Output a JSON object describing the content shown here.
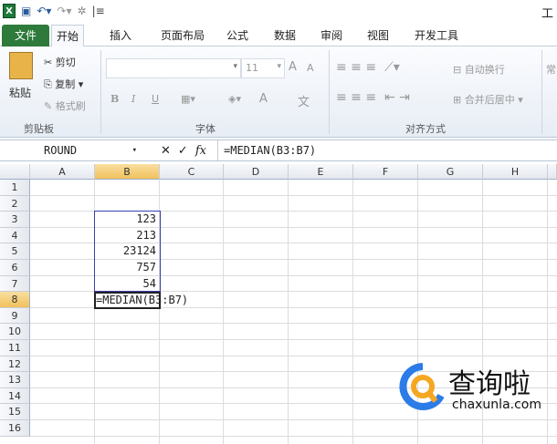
{
  "window": {
    "title": "工"
  },
  "tabs": [
    "文件",
    "开始",
    "插入",
    "页面布局",
    "公式",
    "数据",
    "审阅",
    "视图",
    "开发工具"
  ],
  "ribbon": {
    "clipboard": {
      "paste": "粘贴",
      "cut": "剪切",
      "copy": "复制",
      "format_painter": "格式刷",
      "label": "剪贴板"
    },
    "font": {
      "font_name": "",
      "font_size": "11",
      "label": "字体",
      "bold": "B",
      "italic": "I",
      "underline": "U",
      "font_color": "A",
      "grow": "A",
      "shrink": "A",
      "phonetic": "文"
    },
    "alignment": {
      "wrap_text": "自动换行",
      "merge_center": "合并后居中",
      "label": "对齐方式"
    },
    "number": {
      "format": "常"
    }
  },
  "formula_bar": {
    "name_box": "ROUND",
    "cancel": "✕",
    "enter": "✓",
    "fx": "fx",
    "formula": "=MEDIAN(B3:B7)"
  },
  "sheet": {
    "columns": [
      "A",
      "B",
      "C",
      "D",
      "E",
      "F",
      "G",
      "H"
    ],
    "rows": [
      "1",
      "2",
      "3",
      "4",
      "5",
      "6",
      "7",
      "8",
      "9",
      "10",
      "11",
      "12",
      "13",
      "14",
      "15",
      "16"
    ],
    "values": [
      "123",
      "213",
      "23124",
      "757",
      "54"
    ],
    "editing": "=MEDIAN(B3:B7)",
    "selected_column": "B",
    "selected_row": "8"
  },
  "watermark": {
    "name": "查询啦",
    "url": "chaxunla.com",
    "colors": {
      "ring": "#2b7be8",
      "lens": "#f5a623"
    }
  }
}
